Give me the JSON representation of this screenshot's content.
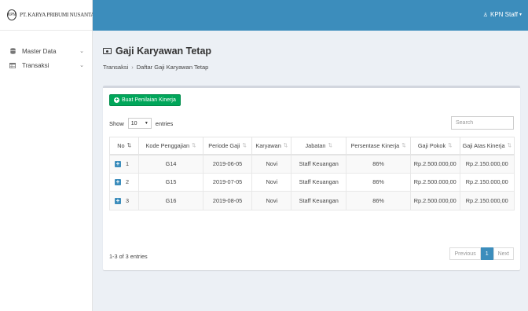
{
  "brand": {
    "logo_text": "KPN",
    "name": "PT. KARYA PRIBUMI NUSANTARA"
  },
  "sidebar": {
    "items": [
      {
        "label": "Master Data",
        "icon": "database-icon"
      },
      {
        "label": "Transaksi",
        "icon": "table-icon"
      }
    ]
  },
  "topbar": {
    "user_name": "KPN Staff",
    "accent": "#3c8dbc"
  },
  "page": {
    "title": "Gaji Karyawan Tetap",
    "breadcrumb": [
      "Transaksi",
      "Daftar Gaji Karyawan Tetap"
    ]
  },
  "toolbar": {
    "add_button": "Buat Penilaian Kinerja",
    "add_button_color": "#00a65a",
    "show_label": "Show",
    "entries_value": "10",
    "entries_label": "entries",
    "search_placeholder": "Search"
  },
  "table": {
    "columns": [
      "No",
      "Kode Penggajian",
      "Periode Gaji",
      "Karyawan",
      "Jabatan",
      "Persentase Kinerja",
      "Gaji Pokok",
      "Gaji Atas Kinerja"
    ],
    "rows": [
      [
        "1",
        "G14",
        "2019-06-05",
        "Novi",
        "Staff Keuangan",
        "86%",
        "Rp.2.500.000,00",
        "Rp.2.150.000,00"
      ],
      [
        "2",
        "G15",
        "2019-07-05",
        "Novi",
        "Staff Keuangan",
        "86%",
        "Rp.2.500.000,00",
        "Rp.2.150.000,00"
      ],
      [
        "3",
        "G16",
        "2019-08-05",
        "Novi",
        "Staff Keuangan",
        "86%",
        "Rp.2.500.000,00",
        "Rp.2.150.000,00"
      ]
    ]
  },
  "footer": {
    "info": "1-3 of 3 entries",
    "previous": "Previous",
    "current_page": "1",
    "next": "Next"
  }
}
